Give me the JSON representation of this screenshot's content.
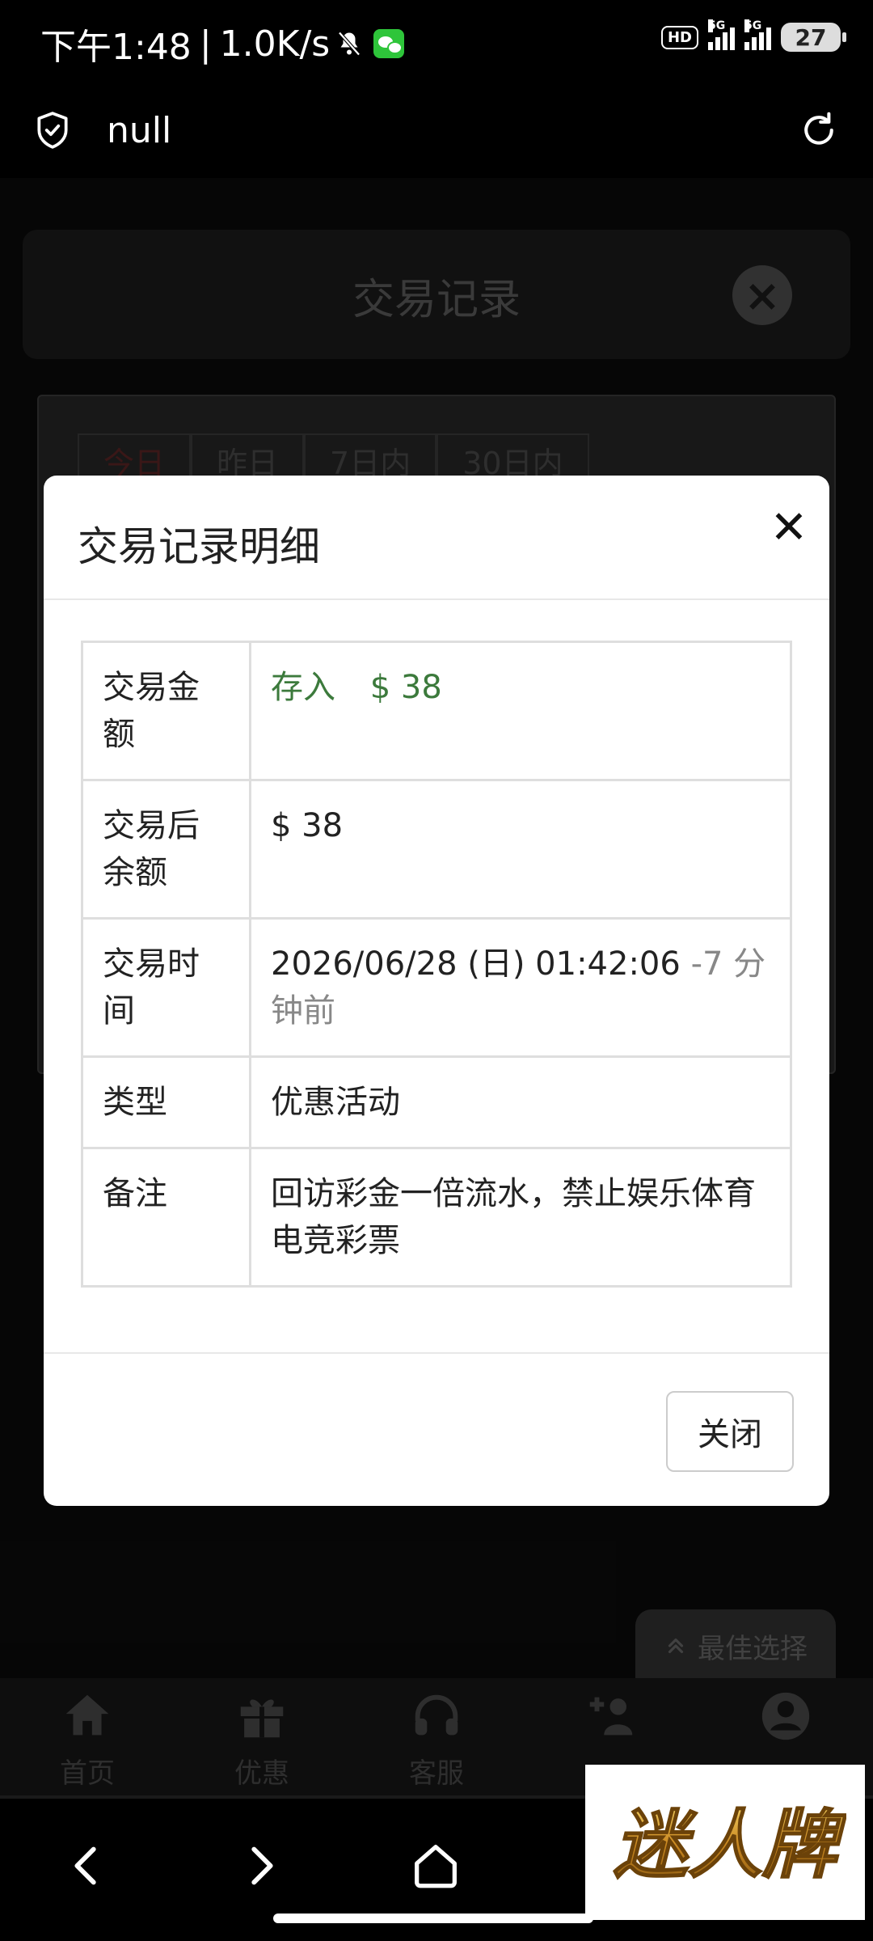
{
  "status_bar": {
    "time": "下午1:48",
    "separator": "|",
    "speed": "1.0K/s",
    "hd": "HD",
    "network_1": "5G",
    "network_2": "5G",
    "battery": "27"
  },
  "browser": {
    "title": "null"
  },
  "background_page": {
    "panel_title": "交易记录",
    "tabs": [
      "今日",
      "昨日",
      "7日内",
      "30日内"
    ],
    "best_choice": "最佳选择",
    "nav": [
      {
        "label": "首页",
        "icon": "home-icon"
      },
      {
        "label": "优惠",
        "icon": "gift-icon"
      },
      {
        "label": "客服",
        "icon": "headset-icon"
      },
      {
        "label": "",
        "icon": "add-user-icon"
      },
      {
        "label": "",
        "icon": "user-icon"
      }
    ]
  },
  "brand_logo": {
    "text": "迷人牌"
  },
  "modal": {
    "title": "交易记录明细",
    "rows": [
      {
        "label": "交易金额",
        "type_text": "存入",
        "amount": "$ 38"
      },
      {
        "label": "交易后余额",
        "value": "$ 38"
      },
      {
        "label": "交易时间",
        "value": "2026/06/28 (日) 01:42:06",
        "relative": "-7 分钟前"
      },
      {
        "label": "类型",
        "value": "优惠活动"
      },
      {
        "label": "备注",
        "value": "回访彩金一倍流水，禁止娱乐体育电竞彩票"
      }
    ],
    "close_label": "关闭"
  },
  "colors": {
    "amount_green": "#3c7a3c",
    "muted_gray": "#888888",
    "modal_bg": "#ffffff",
    "page_bg": "#000000"
  }
}
